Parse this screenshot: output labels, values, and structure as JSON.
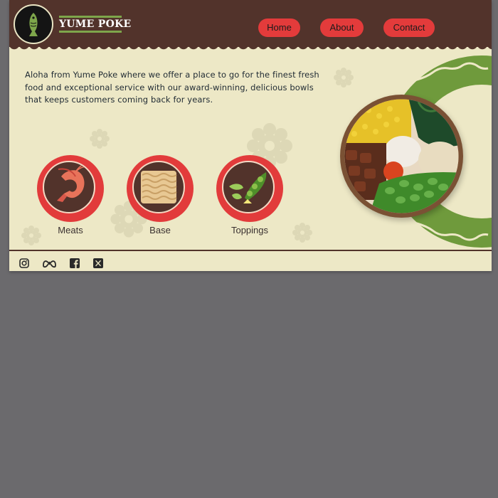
{
  "brand": {
    "name": "YUME POKE"
  },
  "nav": {
    "home": "Home",
    "about": "About",
    "contact": "Contact"
  },
  "intro": {
    "text": "Aloha from Yume Poke where we offer a place to go for the finest fresh food and exceptional service with our award-winning, delicious bowls that keeps customers coming back for years."
  },
  "categories": [
    {
      "label": "Meats"
    },
    {
      "label": "Base"
    },
    {
      "label": "Toppings"
    }
  ],
  "social": [
    "instagram-icon",
    "meta-icon",
    "facebook-icon",
    "x-icon"
  ],
  "colors": {
    "header": "#52332b",
    "background": "#ede8c6",
    "accent_red": "#e33b3b",
    "accent_green": "#6f9a3c"
  }
}
